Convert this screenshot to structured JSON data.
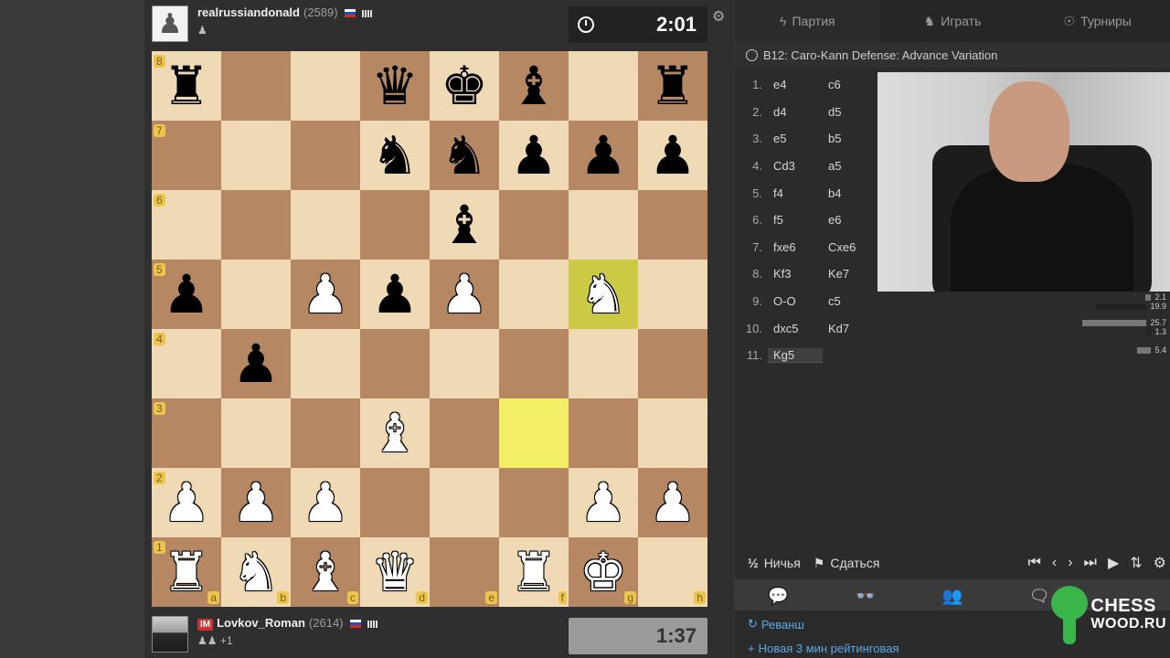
{
  "top_player": {
    "name": "realrussiandonald",
    "rating": "(2589)",
    "sub_icon": "pawn-icon",
    "clock": "2:01"
  },
  "bottom_player": {
    "title": "IM",
    "name": "Lovkov_Roman",
    "rating": "(2614)",
    "sub": "+1",
    "clock": "1:37"
  },
  "board": {
    "ranks": [
      "8",
      "7",
      "6",
      "5",
      "4",
      "3",
      "2",
      "1"
    ],
    "files": [
      "a",
      "b",
      "c",
      "d",
      "e",
      "f",
      "g",
      "h"
    ],
    "rows": [
      [
        "♜",
        "",
        "",
        "♛",
        "♚",
        "♝",
        "",
        "♜"
      ],
      [
        "",
        "",
        "",
        "♞",
        "♞",
        "♟",
        "♟",
        "♟"
      ],
      [
        "",
        "",
        "",
        "",
        "♝",
        "",
        "",
        ""
      ],
      [
        "♟",
        "",
        "♙",
        "♟",
        "♙",
        "",
        "♘",
        ""
      ],
      [
        "",
        "♟",
        "",
        "",
        "",
        "",
        "",
        ""
      ],
      [
        "",
        "",
        "",
        "♗",
        "",
        "",
        "",
        ""
      ],
      [
        "♙",
        "♙",
        "♙",
        "",
        "",
        "",
        "♙",
        "♙"
      ],
      [
        "♖",
        "♘",
        "♗",
        "♕",
        "",
        "♖",
        "♔",
        ""
      ]
    ]
  },
  "tabs": [
    "Партия",
    "Играть",
    "Турниры"
  ],
  "opening": "B12: Caro-Kann Defense: Advance Variation",
  "moves": [
    {
      "n": "1.",
      "w": "e4",
      "b": "c6"
    },
    {
      "n": "2.",
      "w": "d4",
      "b": "d5"
    },
    {
      "n": "3.",
      "w": "e5",
      "b": "b5"
    },
    {
      "n": "4.",
      "w": "Cd3",
      "b": "a5"
    },
    {
      "n": "5.",
      "w": "f4",
      "b": "b4"
    },
    {
      "n": "6.",
      "w": "f5",
      "b": "e6"
    },
    {
      "n": "7.",
      "w": "fxe6",
      "b": "Cxe6"
    },
    {
      "n": "8.",
      "w": "Kf3",
      "b": "Ke7"
    },
    {
      "n": "9.",
      "w": "O-O",
      "b": "c5"
    },
    {
      "n": "10.",
      "w": "dxc5",
      "b": "Kd7"
    },
    {
      "n": "11.",
      "w": "Kg5",
      "b": ""
    }
  ],
  "evals": [
    {
      "v": "2.1",
      "frac": 0.06,
      "dark": false
    },
    {
      "v": "19.9",
      "frac": 0.55,
      "dark": true
    },
    {
      "v": "25.7",
      "frac": 0.7,
      "dark": false
    },
    {
      "v": "1.3",
      "frac": 0.04,
      "dark": true
    },
    {
      "v": "5.4",
      "frac": 0.15,
      "dark": false
    }
  ],
  "controls": {
    "draw": "Ничья",
    "draw_glyph": "½",
    "resign": "Сдаться"
  },
  "actions": {
    "rematch": "Реванш",
    "new_game": "Новая 3 мин рейтинговая"
  },
  "logo": {
    "line1": "CHESS",
    "line2": "WOOD.RU"
  }
}
